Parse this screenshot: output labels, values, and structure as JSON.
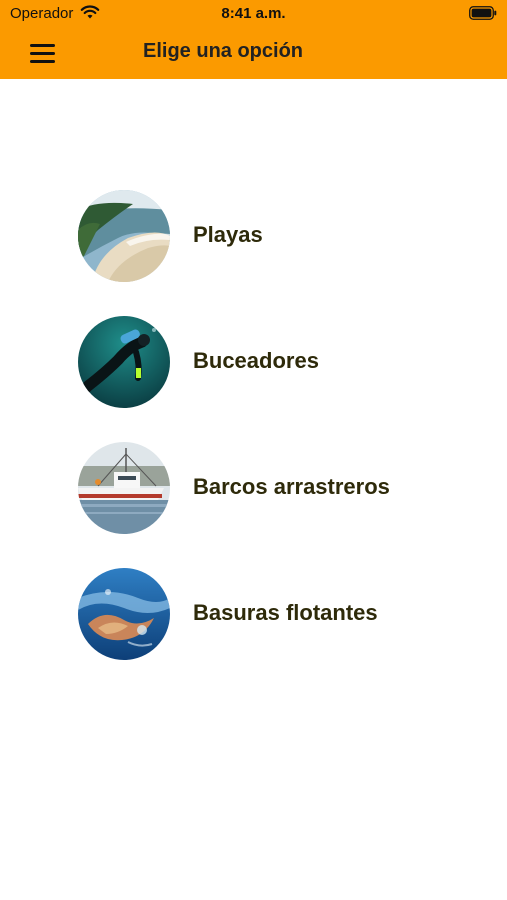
{
  "status_bar": {
    "carrier": "Operador",
    "time": "8:41 a.m."
  },
  "nav": {
    "title": "Elige una opción",
    "menu_icon": "hamburger-menu-icon"
  },
  "colors": {
    "nav_background": "#fb9a00",
    "label_text": "#2e2a0a"
  },
  "options": [
    {
      "label": "Playas",
      "image": "beach-photo"
    },
    {
      "label": "Buceadores",
      "image": "diver-photo"
    },
    {
      "label": "Barcos arrastreros",
      "image": "trawler-boat-photo"
    },
    {
      "label": "Basuras flotantes",
      "image": "floating-trash-photo"
    }
  ]
}
